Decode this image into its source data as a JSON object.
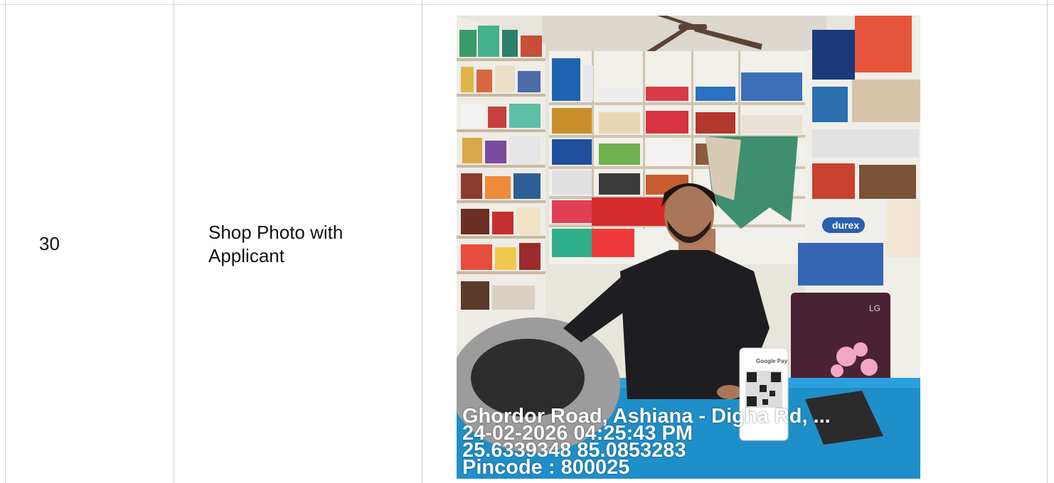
{
  "row": {
    "number": "30",
    "label": "Shop Photo with Applicant"
  },
  "photo": {
    "stamp_address": "Ghordor Road, Ashiana - Digha Rd, ...",
    "stamp_datetime": "24-02-2026 04:25:43 PM",
    "stamp_coordinates": "25.6339348 85.0853283",
    "stamp_pincode": "Pincode : 800025",
    "gpay_text": "Google Pay",
    "durex_text": "durex",
    "fridge_brand": "LG"
  },
  "colors": {
    "border": "#d0d0d0",
    "counter_blue": "#1f8fc9",
    "shirt_black": "#1e1e22",
    "wall_white": "#f2f0ea"
  }
}
